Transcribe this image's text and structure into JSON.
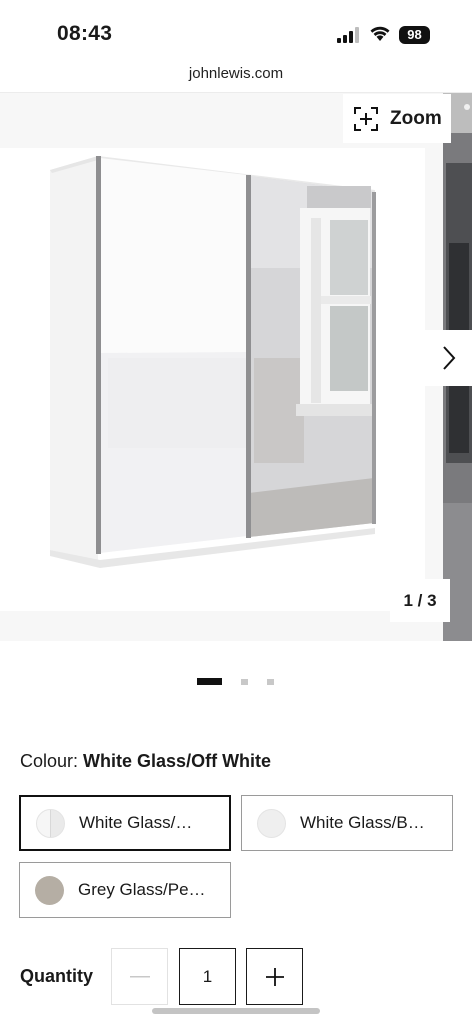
{
  "status_bar": {
    "time": "08:43",
    "battery": "98"
  },
  "browser": {
    "url": "johnlewis.com"
  },
  "gallery": {
    "zoom_label": "Zoom",
    "counter": "1 / 3",
    "current_slide": 1,
    "total_slides": 3
  },
  "product": {
    "colour_label": "Colour:",
    "colour_value": "White Glass/Off White",
    "colour_options": [
      {
        "label": "White Glass/…",
        "selected": true,
        "swatch": "#f0f0f0"
      },
      {
        "label": "White Glass/B…",
        "selected": false,
        "swatch": "#eeeeee"
      },
      {
        "label": "Grey Glass/Pe…",
        "selected": false,
        "swatch": "#b5aea4"
      }
    ]
  },
  "quantity": {
    "label": "Quantity",
    "value": "1",
    "minus": "−",
    "plus": "+"
  }
}
